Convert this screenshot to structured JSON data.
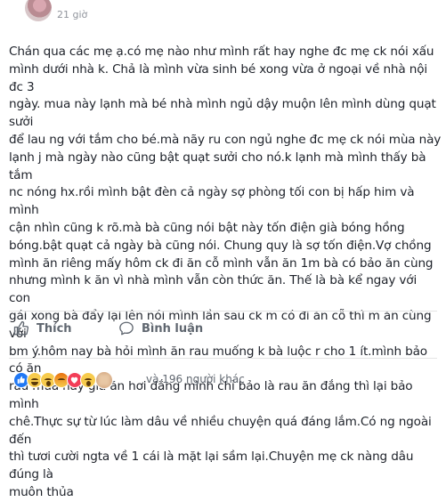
{
  "post": {
    "timestamp": "21 giờ",
    "body": "Chán qua các mẹ ạ.có mẹ nào như mình rất hay nghe đc mẹ ck nói xấu\nmình dưới nhà k. Chả là mình vừa sinh bé xong vừa ở ngoại về nhà nội đc 3\nngày. mua này lạnh mà bé nhà mình ngủ dậy muộn lên mình dùng quạt sưởi\nđể lau ng với tắm cho bé.mà nãy ru con ngủ nghe đc mẹ ck nói mùa này\nlạnh j mà ngày nào cũng bật quạt sưởi cho nó.k lạnh mà mình thấy bà tắm\nnc nóng hx.rồi mình bật đèn cả ngày sợ phòng tối con bị hấp him và mình\ncận nhìn cũng k rõ.mà bà cũng nói bật này tốn điện già bóng hồng\nbóng.bật quạt cả ngày bà cũng nói. Chung quy là sợ tốn điện.Vợ chồng\nmình ăn riêng mấy hôm ck đi ăn cỗ mình vẫn ăn 1m bà có bảo ăn cùng\nnhưng mình k ăn vì nhà mình vẫn còn thức ăn. Thế là bà kể ngay với con\ngái xong bà đẩy lại lên nói mình lần sau ck m có đi ăn cỗ thì m ăn cùng với\nbm ý.hôm nay bà hỏi mình ăn rau muống k bà luộc r cho 1 ít.mình bảo có ăn\nrau mùa này già ăn hơi đắng mình chỉ bảo là rau ăn đắng thì lại bảo mình\nchê.Thực sự từ lúc làm dâu về nhiều chuyện quá đáng lắm.Có ng ngoài đến\nthì tươi cười ngta về 1 cái là mặt lại sầm lại.Chuyện mẹ ck nàng dâu đúng là\nmuôn thủa"
  },
  "actions": {
    "like_label": "Thích",
    "comment_label": "Bình luận"
  },
  "reactions": {
    "icons": [
      "like-icon",
      "haha-icon",
      "wow-icon",
      "angry-icon",
      "love-icon",
      "wow-icon"
    ],
    "count_text": "và 196 người khác"
  },
  "colors": {
    "text": "#1d2129",
    "secondary_text": "#606770",
    "timestamp": "#90949c",
    "divider": "#e5e5e5",
    "like_blue": "#2078f4"
  }
}
